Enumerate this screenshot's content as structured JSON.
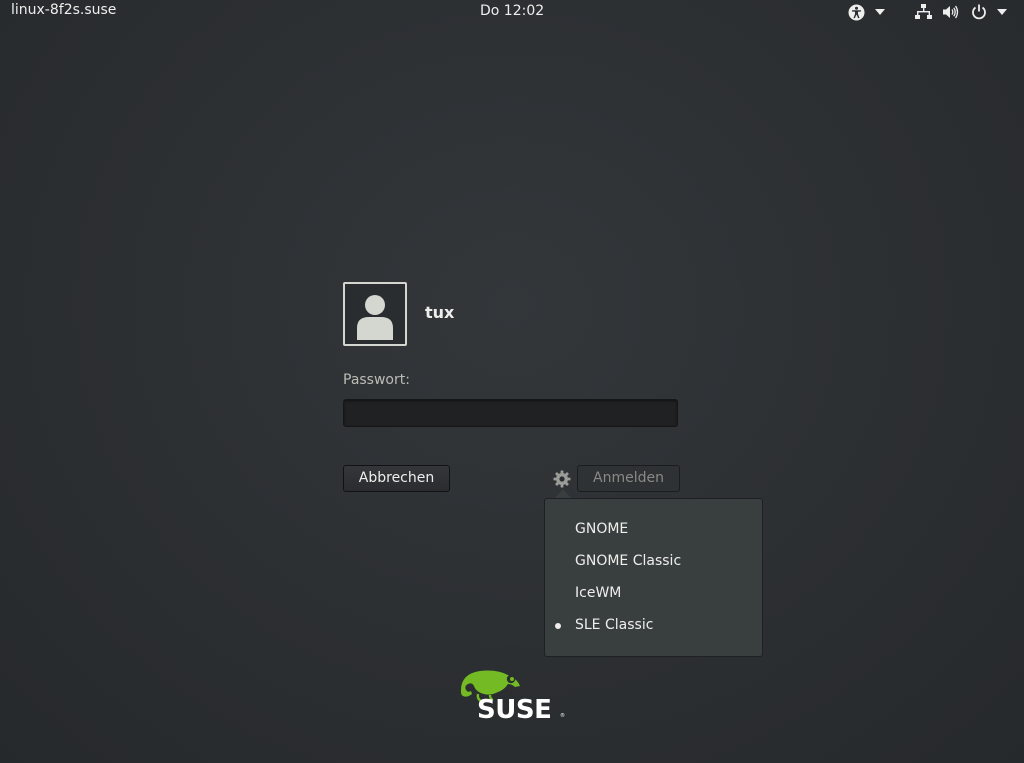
{
  "topbar": {
    "hostname": "linux-8f2s.suse",
    "clock": "Do 12:02",
    "icons": [
      "accessibility-icon",
      "chevron-down-icon",
      "network-icon",
      "volume-icon",
      "power-icon",
      "chevron-down-icon"
    ]
  },
  "user": {
    "name": "tux",
    "avatar_icon": "user-icon"
  },
  "login": {
    "password_label": "Passwort:",
    "password_value": "",
    "password_placeholder": "",
    "cancel_label": "Abbrechen",
    "login_label": "Anmelden",
    "settings_icon": "gear-icon"
  },
  "session_menu": {
    "items": [
      {
        "label": "GNOME",
        "selected": false
      },
      {
        "label": "GNOME Classic",
        "selected": false
      },
      {
        "label": "IceWM",
        "selected": false
      },
      {
        "label": "SLE Classic",
        "selected": true
      }
    ]
  },
  "branding": {
    "logo_text": "SUSE",
    "logo_color": "#73ba25"
  },
  "colors": {
    "background": "#2b2e31",
    "menu_background": "#393f3f",
    "text": "#eeeeec"
  }
}
